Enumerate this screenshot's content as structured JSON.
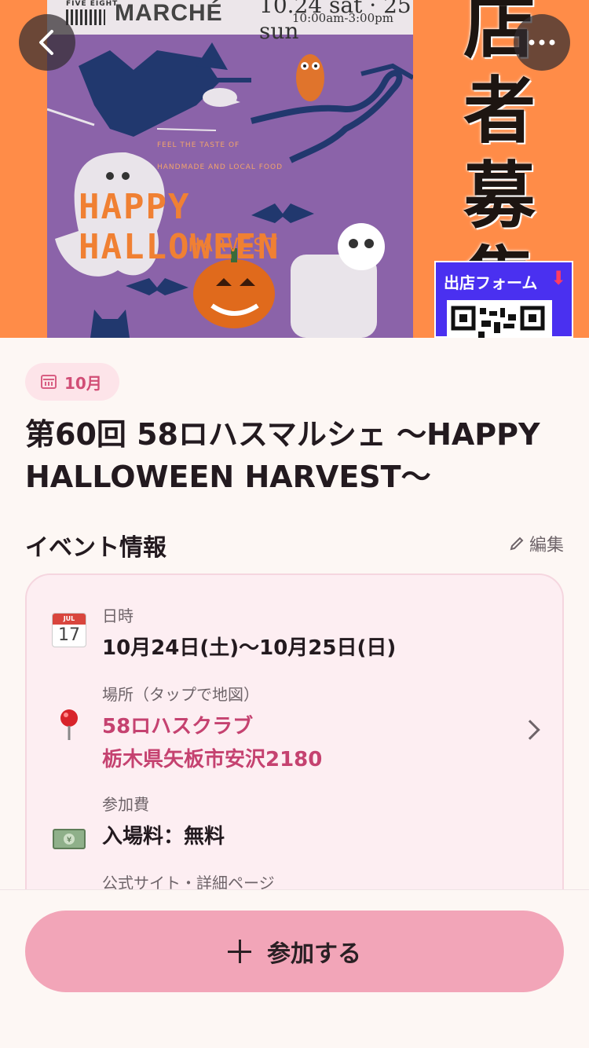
{
  "hero": {
    "poster_brand": "FIVE EIGHT",
    "poster_title": "MARCHÉ",
    "poster_dates": "10.24 sat · 25 sun",
    "poster_time": "10:00am-3:00pm",
    "poster_sub_line1": "FEEL THE TASTE OF",
    "poster_sub_line2": "HANDMADE AND LOCAL FOOD",
    "poster_headline": "HAPPY HALLOWEEN",
    "poster_harvest": "HARVEST",
    "recruit_text": "店者募集",
    "form_label": "出店フォーム"
  },
  "event": {
    "month_badge": "10月",
    "title": "第60回 58ロハスマルシェ 〜HAPPY HALLOWEEN HARVEST〜"
  },
  "section": {
    "title": "イベント情報",
    "edit_label": "編集"
  },
  "info": {
    "calendar_icon_month": "JUL",
    "calendar_icon_day": "17",
    "datetime_label": "日時",
    "datetime_value": "10月24日(土)〜10月25日(日)",
    "place_label": "場所（タップで地図）",
    "place_name": "58ロハスクラブ",
    "place_address": "栃木県矢板市安沢2180",
    "fee_label": "参加費",
    "fee_value": "入場料：無料",
    "site_label": "公式サイト・詳細ページ"
  },
  "footer": {
    "join_label": "参加する"
  },
  "colors": {
    "accent_pink": "#f2a5b8",
    "link_pink": "#c54270",
    "hero_orange": "#ff8c48",
    "poster_purple": "#8b63a9"
  }
}
